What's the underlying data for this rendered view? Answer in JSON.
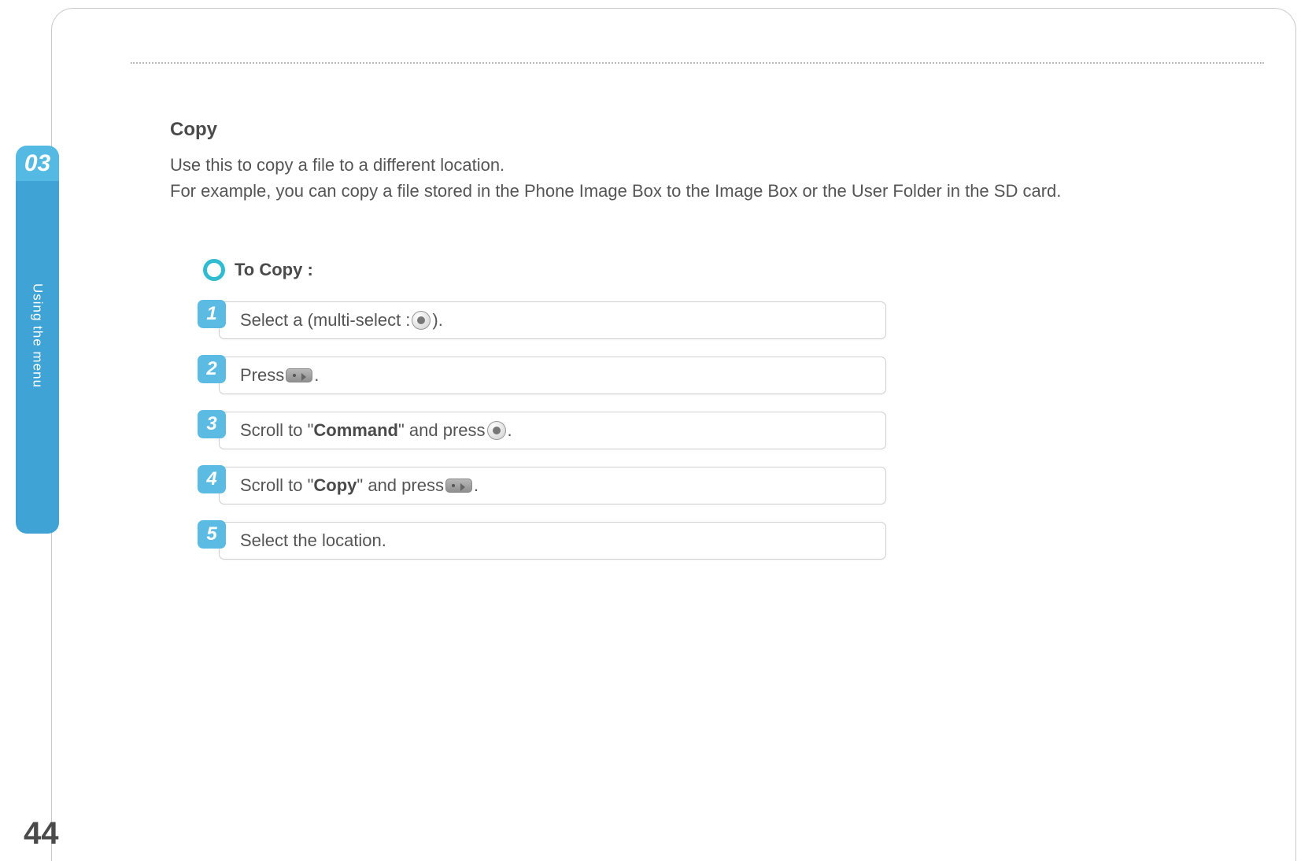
{
  "chapter": {
    "number": "03",
    "tab_label": "Using the menu"
  },
  "page_number": "44",
  "section": {
    "title": "Copy",
    "intro_line1": "Use this to copy a file to a different location.",
    "intro_line2": "For example, you can copy a file stored in the Phone Image Box to the Image Box or the User Folder in the SD card."
  },
  "steps": {
    "heading": "To Copy :",
    "items": [
      {
        "n": "1",
        "before": "Select a (multi-select : ",
        "icon1": "ok-button-icon",
        "after": ")."
      },
      {
        "n": "2",
        "before": "Press ",
        "icon1": "softkey-icon",
        "after": "."
      },
      {
        "n": "3",
        "before": "Scroll to \"",
        "bold": "Command",
        "mid": "\" and press ",
        "icon1": "ok-button-icon",
        "after": "."
      },
      {
        "n": "4",
        "before": "Scroll to \"",
        "bold": "Copy",
        "mid": "\" and press ",
        "icon1": "softkey-icon",
        "after": "."
      },
      {
        "n": "5",
        "before": "Select the location.",
        "after": ""
      }
    ]
  }
}
